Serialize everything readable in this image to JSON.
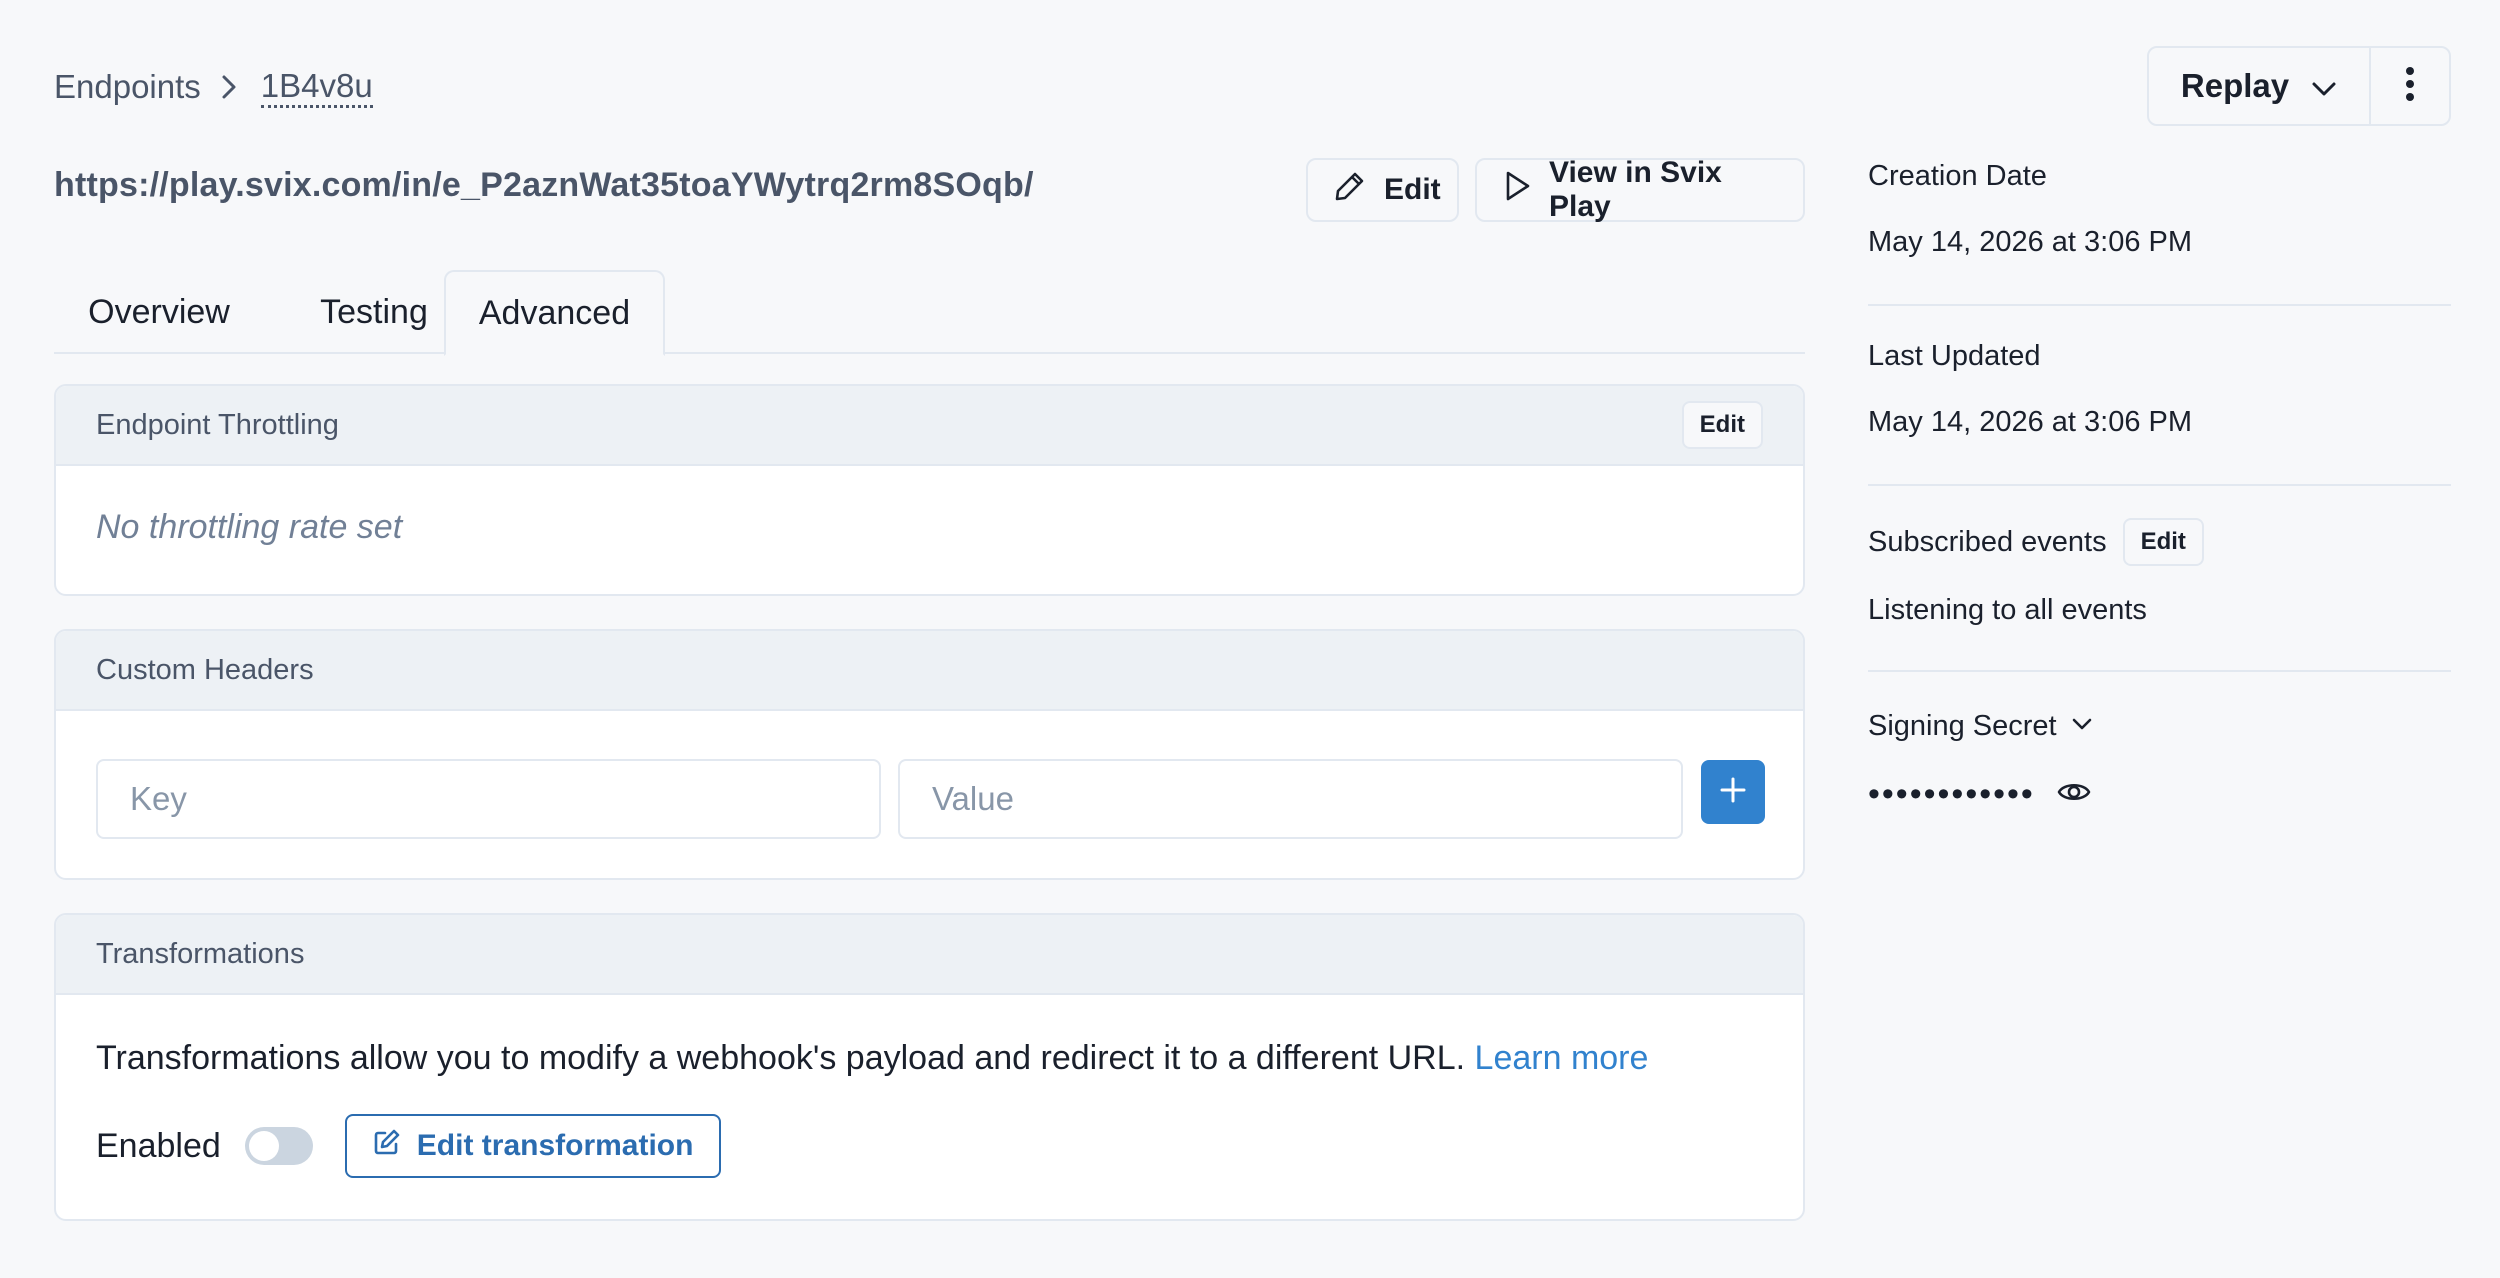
{
  "breadcrumb": {
    "root": "Endpoints",
    "current": "1B4v8u"
  },
  "header": {
    "replay_label": "Replay"
  },
  "endpoint": {
    "url": "https://play.svix.com/in/e_P2aznWat35toaYWytrq2rm8SOqb/",
    "edit_label": "Edit",
    "view_play_label": "View in Svix Play"
  },
  "tabs": [
    {
      "label": "Overview"
    },
    {
      "label": "Testing"
    },
    {
      "label": "Advanced"
    }
  ],
  "throttling": {
    "title": "Endpoint Throttling",
    "edit_label": "Edit",
    "empty_text": "No throttling rate set"
  },
  "custom_headers": {
    "title": "Custom Headers",
    "key_placeholder": "Key",
    "value_placeholder": "Value"
  },
  "transformations": {
    "title": "Transformations",
    "description": "Transformations allow you to modify a webhook's payload and redirect it to a different URL.",
    "learn_more": "Learn more",
    "enabled_label": "Enabled",
    "enabled": false,
    "edit_label": "Edit transformation"
  },
  "sidebar": {
    "creation_label": "Creation Date",
    "creation_value": "May 14, 2026 at 3:06 PM",
    "updated_label": "Last Updated",
    "updated_value": "May 14, 2026 at 3:06 PM",
    "events_label": "Subscribed events",
    "events_edit": "Edit",
    "events_value": "Listening to all events",
    "secret_label": "Signing Secret",
    "secret_masked": "••••••••••••"
  },
  "colors": {
    "accent": "#3182ce",
    "background": "#f7f8fa",
    "card_header": "#edf1f5",
    "border": "#e2e8f0"
  }
}
